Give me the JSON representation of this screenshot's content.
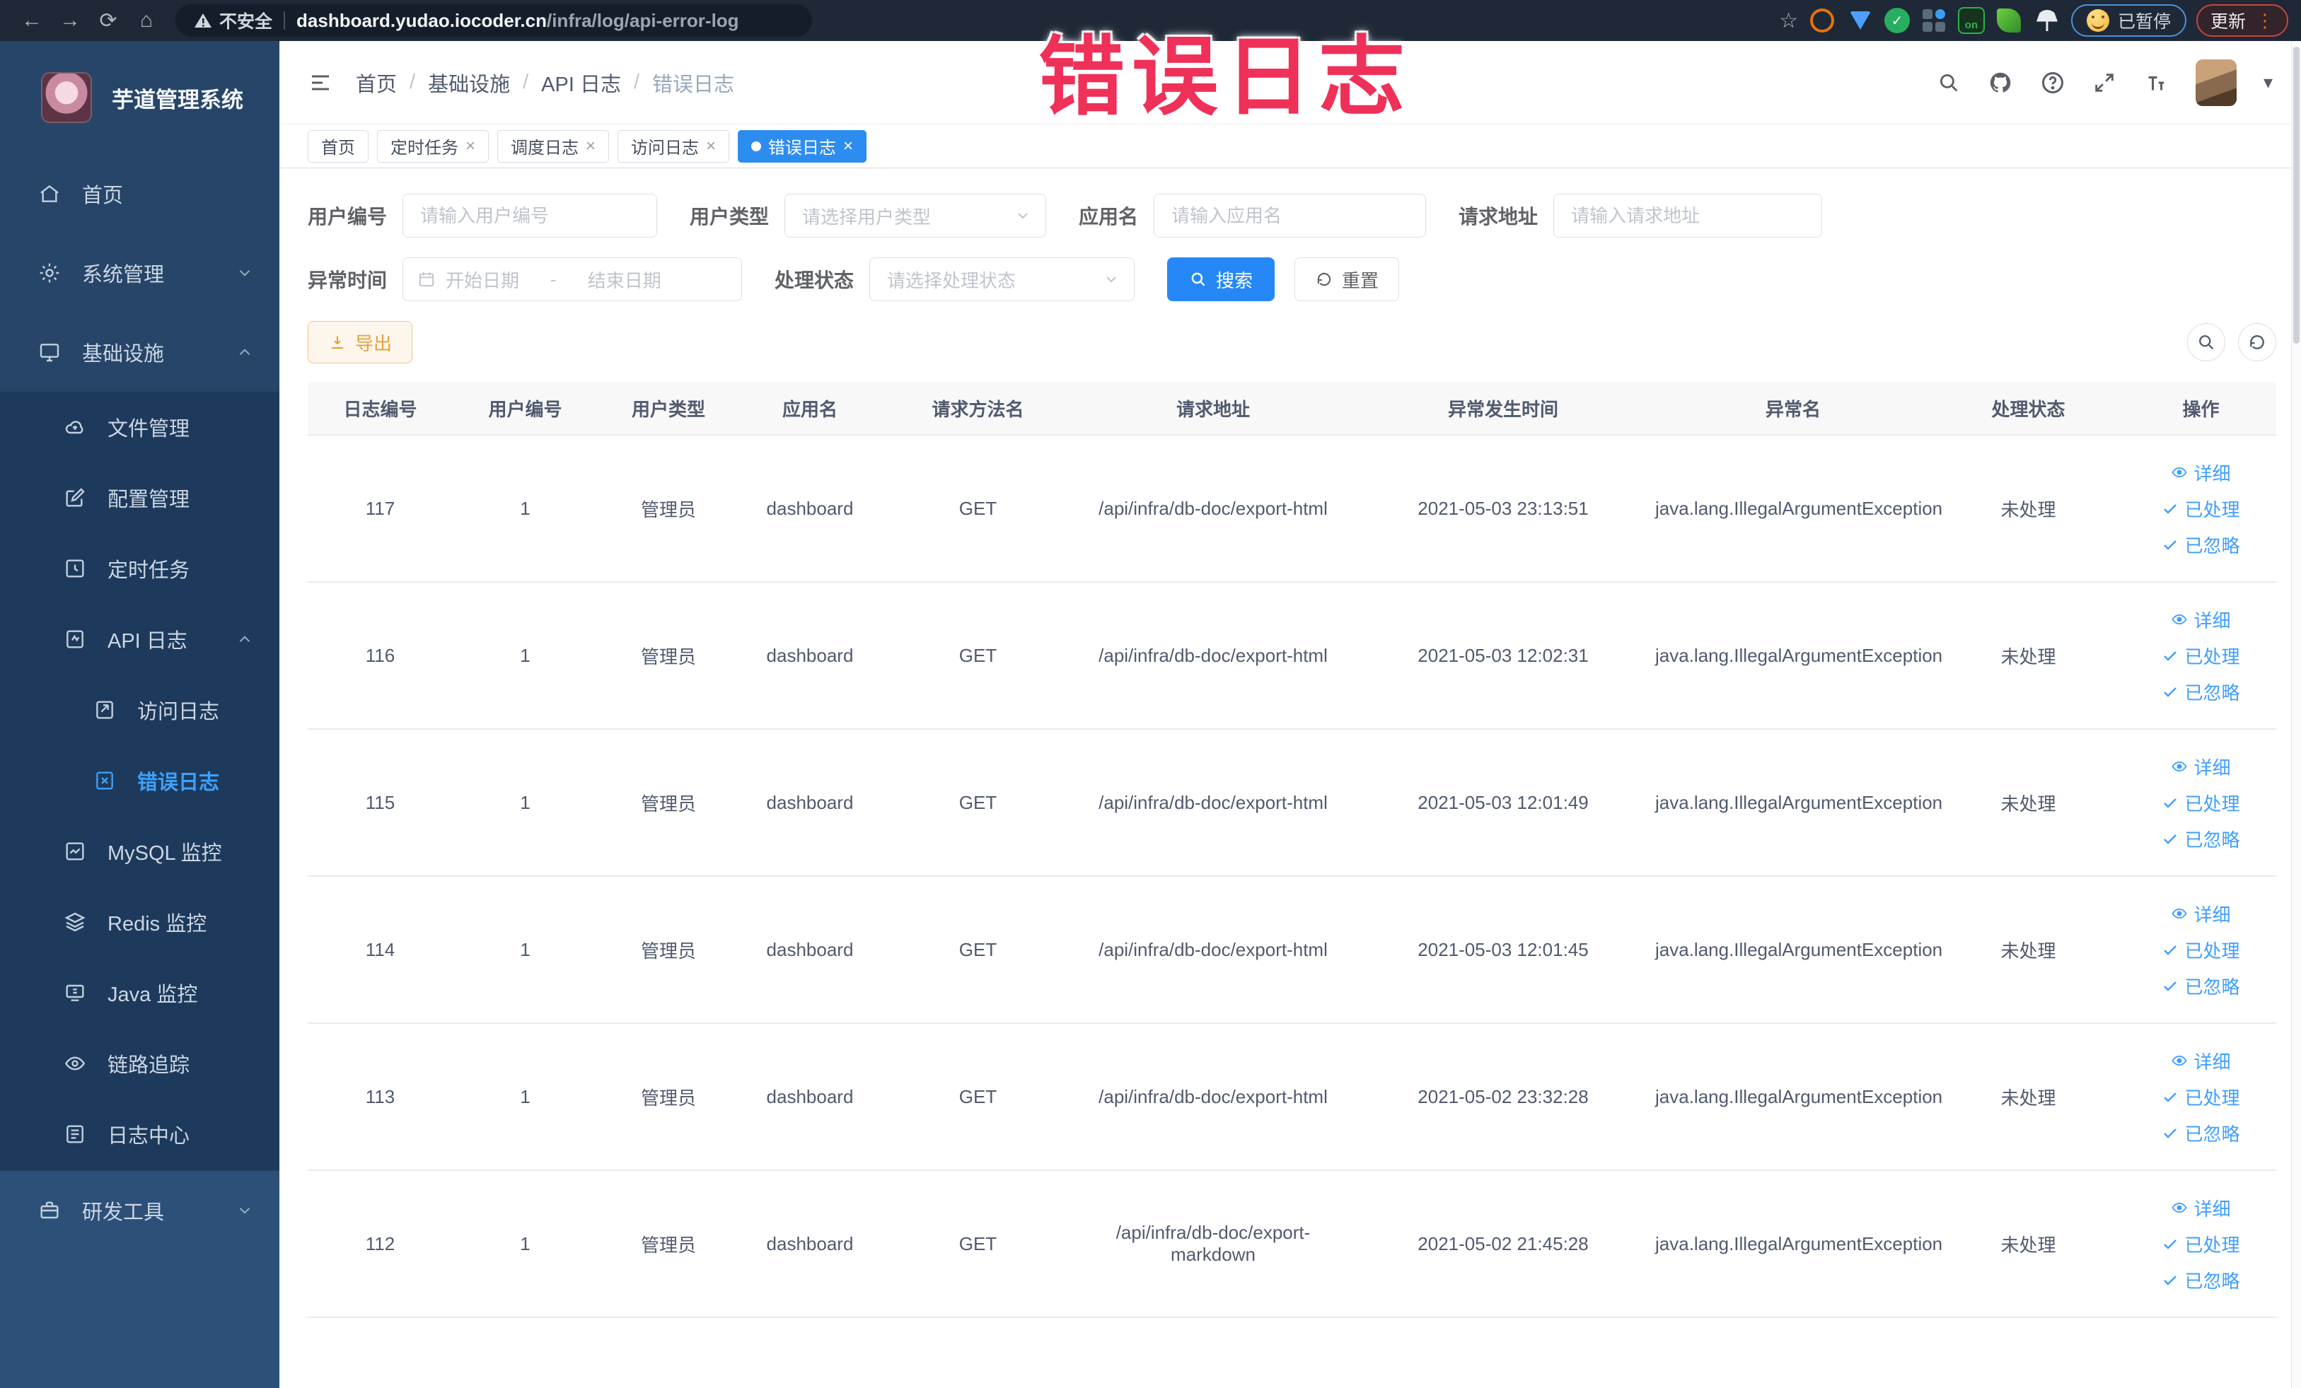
{
  "colors": {
    "accent_blue": "#2d8cf0",
    "link_blue": "#409eff",
    "warning_orange": "#e6a23c",
    "overlay_red": "#ef3058",
    "sidebar_bg": "#264569",
    "sidebar_submenu_bg": "#1d3a5c"
  },
  "browser": {
    "security": "不安全",
    "url_host": "dashboard.yudao.iocoder.cn",
    "url_path": "/infra/log/api-error-log",
    "paused_badge": "已暂停",
    "update_button": "更新"
  },
  "overlay": {
    "text": "错误日志"
  },
  "sidebar": {
    "title": "芋道管理系统",
    "items": [
      {
        "label": "首页"
      },
      {
        "label": "系统管理"
      },
      {
        "label": "基础设施"
      },
      {
        "label": "文件管理"
      },
      {
        "label": "配置管理"
      },
      {
        "label": "定时任务"
      },
      {
        "label": "API 日志"
      },
      {
        "label": "访问日志"
      },
      {
        "label": "错误日志"
      },
      {
        "label": "MySQL 监控"
      },
      {
        "label": "Redis 监控"
      },
      {
        "label": "Java 监控"
      },
      {
        "label": "链路追踪"
      },
      {
        "label": "日志中心"
      },
      {
        "label": "研发工具"
      }
    ]
  },
  "breadcrumb": {
    "items": [
      "首页",
      "基础设施",
      "API 日志",
      "错误日志"
    ]
  },
  "tabs": [
    {
      "label": "首页"
    },
    {
      "label": "定时任务"
    },
    {
      "label": "调度日志"
    },
    {
      "label": "访问日志"
    },
    {
      "label": "错误日志"
    }
  ],
  "filters": {
    "user_id_label": "用户编号",
    "user_id_placeholder": "请输入用户编号",
    "user_type_label": "用户类型",
    "user_type_placeholder": "请选择用户类型",
    "app_name_label": "应用名",
    "app_name_placeholder": "请输入应用名",
    "request_url_label": "请求地址",
    "request_url_placeholder": "请输入请求地址",
    "exception_time_label": "异常时间",
    "date_start_placeholder": "开始日期",
    "date_separator": "-",
    "date_end_placeholder": "结束日期",
    "process_status_label": "处理状态",
    "process_status_placeholder": "请选择处理状态",
    "search_button": "搜索",
    "reset_button": "重置"
  },
  "toolbar": {
    "export_button": "导出"
  },
  "table": {
    "columns": [
      "日志编号",
      "用户编号",
      "用户类型",
      "应用名",
      "请求方法名",
      "请求地址",
      "异常发生时间",
      "异常名",
      "处理状态",
      "操作"
    ],
    "row_actions": [
      "详细",
      "已处理",
      "已忽略"
    ],
    "rows": [
      {
        "cells": [
          "117",
          "1",
          "管理员",
          "dashboard",
          "GET",
          "/api/infra/db-doc/export-html",
          "2021-05-03 23:13:51",
          "java.lang.IllegalArgumentException",
          "未处理"
        ]
      },
      {
        "cells": [
          "116",
          "1",
          "管理员",
          "dashboard",
          "GET",
          "/api/infra/db-doc/export-html",
          "2021-05-03 12:02:31",
          "java.lang.IllegalArgumentException",
          "未处理"
        ]
      },
      {
        "cells": [
          "115",
          "1",
          "管理员",
          "dashboard",
          "GET",
          "/api/infra/db-doc/export-html",
          "2021-05-03 12:01:49",
          "java.lang.IllegalArgumentException",
          "未处理"
        ]
      },
      {
        "cells": [
          "114",
          "1",
          "管理员",
          "dashboard",
          "GET",
          "/api/infra/db-doc/export-html",
          "2021-05-03 12:01:45",
          "java.lang.IllegalArgumentException",
          "未处理"
        ]
      },
      {
        "cells": [
          "113",
          "1",
          "管理员",
          "dashboard",
          "GET",
          "/api/infra/db-doc/export-html",
          "2021-05-02 23:32:28",
          "java.lang.IllegalArgumentException",
          "未处理"
        ]
      },
      {
        "cells": [
          "112",
          "1",
          "管理员",
          "dashboard",
          "GET",
          "/api/infra/db-doc/export-markdown",
          "2021-05-02 21:45:28",
          "java.lang.IllegalArgumentException",
          "未处理"
        ]
      }
    ]
  }
}
